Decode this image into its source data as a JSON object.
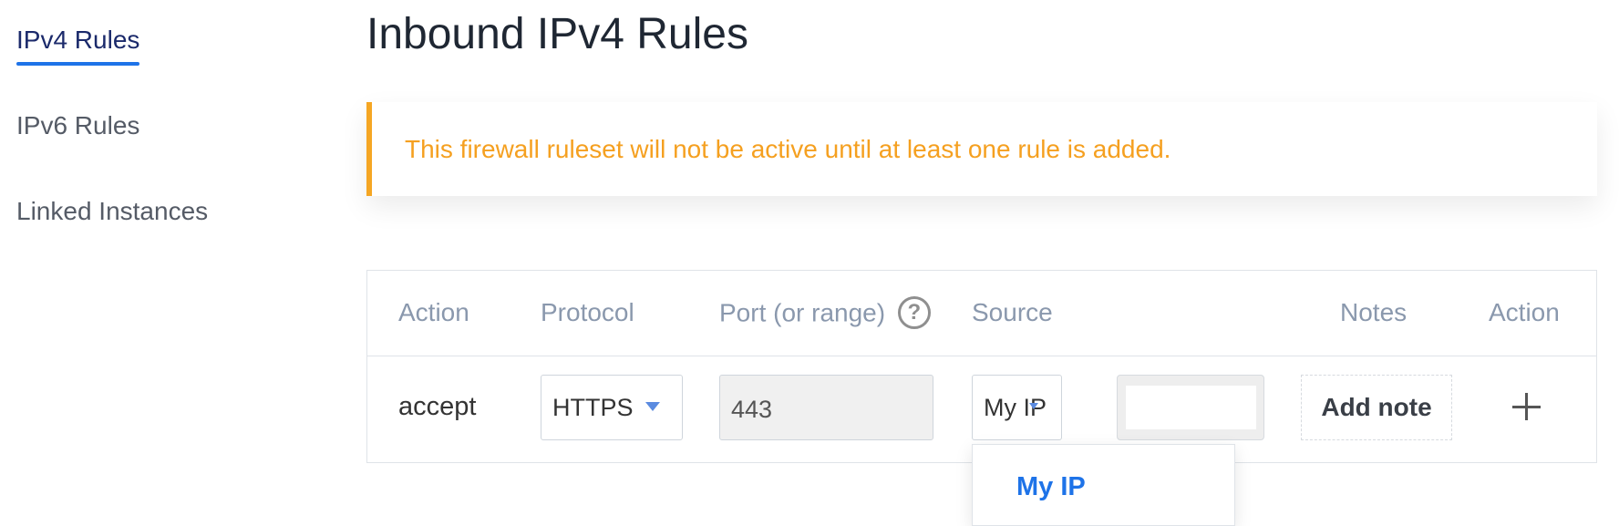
{
  "sidebar": {
    "items": [
      {
        "label": "IPv4 Rules",
        "active": true
      },
      {
        "label": "IPv6 Rules",
        "active": false
      },
      {
        "label": "Linked Instances",
        "active": false
      }
    ]
  },
  "page": {
    "title": "Inbound IPv4 Rules"
  },
  "notice": {
    "text": "This firewall ruleset will not be active until at least one rule is added.",
    "accent_color": "#f5a623"
  },
  "table": {
    "headers": {
      "action": "Action",
      "protocol": "Protocol",
      "port": "Port (or range)",
      "source": "Source",
      "notes": "Notes",
      "action2": "Action"
    },
    "row": {
      "action": "accept",
      "protocol": "HTTPS",
      "port": "443",
      "source": "My IP",
      "ip_value": "",
      "add_note_label": "Add note"
    }
  },
  "source_dropdown": {
    "options": [
      "My IP"
    ]
  },
  "icons": {
    "help": "help-circle-icon",
    "caret": "chevron-down-icon",
    "add": "plus-icon"
  }
}
